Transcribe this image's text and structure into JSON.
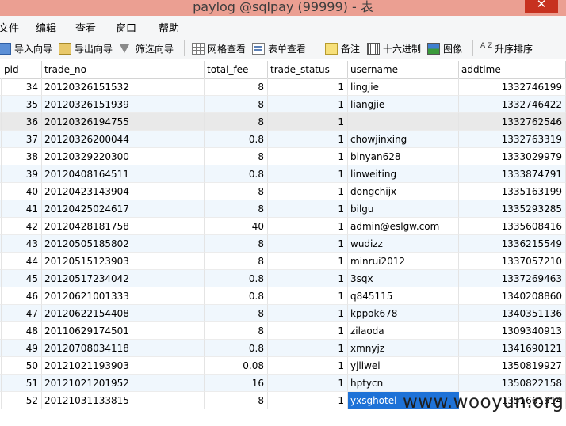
{
  "window": {
    "title": "paylog @sqlpay (99999) - 表",
    "close_glyph": "✕"
  },
  "menu": [
    "文件",
    "编辑",
    "查看",
    "窗口",
    "帮助"
  ],
  "toolbar": {
    "import_wizard": "导入向导",
    "export_wizard": "导出向导",
    "filter_wizard": "筛选向导",
    "grid_view": "网格查看",
    "form_view": "表单查看",
    "memo": "备注",
    "hex": "十六进制",
    "image": "图像",
    "sort": "升序排序",
    "sort_icon_glyph": "A Z"
  },
  "columns": [
    "pid",
    "trade_no",
    "total_fee",
    "trade_status",
    "username",
    "addtime"
  ],
  "rows": [
    {
      "pid": "34",
      "trade_no": "20120326151532",
      "total_fee": "8",
      "trade_status": "1",
      "username": "lingjie",
      "addtime": "1332746199"
    },
    {
      "pid": "35",
      "trade_no": "20120326151939",
      "total_fee": "8",
      "trade_status": "1",
      "username": "liangjie",
      "addtime": "1332746422"
    },
    {
      "pid": "36",
      "trade_no": "20120326194755",
      "total_fee": "8",
      "trade_status": "1",
      "username": "",
      "addtime": "1332762546"
    },
    {
      "pid": "37",
      "trade_no": "20120326200044",
      "total_fee": "0.8",
      "trade_status": "1",
      "username": "chowjinxing",
      "addtime": "1332763319"
    },
    {
      "pid": "38",
      "trade_no": "20120329220300",
      "total_fee": "8",
      "trade_status": "1",
      "username": "binyan628",
      "addtime": "1333029979"
    },
    {
      "pid": "39",
      "trade_no": "20120408164511",
      "total_fee": "0.8",
      "trade_status": "1",
      "username": "linweiting",
      "addtime": "1333874791"
    },
    {
      "pid": "40",
      "trade_no": "20120423143904",
      "total_fee": "8",
      "trade_status": "1",
      "username": "dongchijx",
      "addtime": "1335163199"
    },
    {
      "pid": "41",
      "trade_no": "20120425024617",
      "total_fee": "8",
      "trade_status": "1",
      "username": "bilgu",
      "addtime": "1335293285"
    },
    {
      "pid": "42",
      "trade_no": "20120428181758",
      "total_fee": "40",
      "trade_status": "1",
      "username": "admin@eslgw.com",
      "addtime": "1335608416"
    },
    {
      "pid": "43",
      "trade_no": "20120505185802",
      "total_fee": "8",
      "trade_status": "1",
      "username": "wudizz",
      "addtime": "1336215549"
    },
    {
      "pid": "44",
      "trade_no": "20120515123903",
      "total_fee": "8",
      "trade_status": "1",
      "username": "minrui2012",
      "addtime": "1337057210"
    },
    {
      "pid": "45",
      "trade_no": "20120517234042",
      "total_fee": "0.8",
      "trade_status": "1",
      "username": "3sqx",
      "addtime": "1337269463"
    },
    {
      "pid": "46",
      "trade_no": "20120621001333",
      "total_fee": "0.8",
      "trade_status": "1",
      "username": "q845115",
      "addtime": "1340208860"
    },
    {
      "pid": "47",
      "trade_no": "20120622154408",
      "total_fee": "8",
      "trade_status": "1",
      "username": "kppok678",
      "addtime": "1340351136"
    },
    {
      "pid": "48",
      "trade_no": "20110629174501",
      "total_fee": "8",
      "trade_status": "1",
      "username": "zilaoda",
      "addtime": "1309340913"
    },
    {
      "pid": "49",
      "trade_no": "20120708034118",
      "total_fee": "0.8",
      "trade_status": "1",
      "username": "xmnyjz",
      "addtime": "1341690121"
    },
    {
      "pid": "50",
      "trade_no": "20121021193903",
      "total_fee": "0.08",
      "trade_status": "1",
      "username": "yjliwei",
      "addtime": "1350819927"
    },
    {
      "pid": "51",
      "trade_no": "20121021201952",
      "total_fee": "16",
      "trade_status": "1",
      "username": "hptycn",
      "addtime": "1350822158"
    },
    {
      "pid": "52",
      "trade_no": "20121031133815",
      "total_fee": "8",
      "trade_status": "1",
      "username": "yxsghotel",
      "addtime": "1351661914"
    }
  ],
  "watermark": "www.wooyun.org",
  "colors": {
    "titlebar": "#eb9f92",
    "close_button": "#c7311f",
    "selection": "#1e72d7",
    "stripe": "#f0f7fd"
  }
}
